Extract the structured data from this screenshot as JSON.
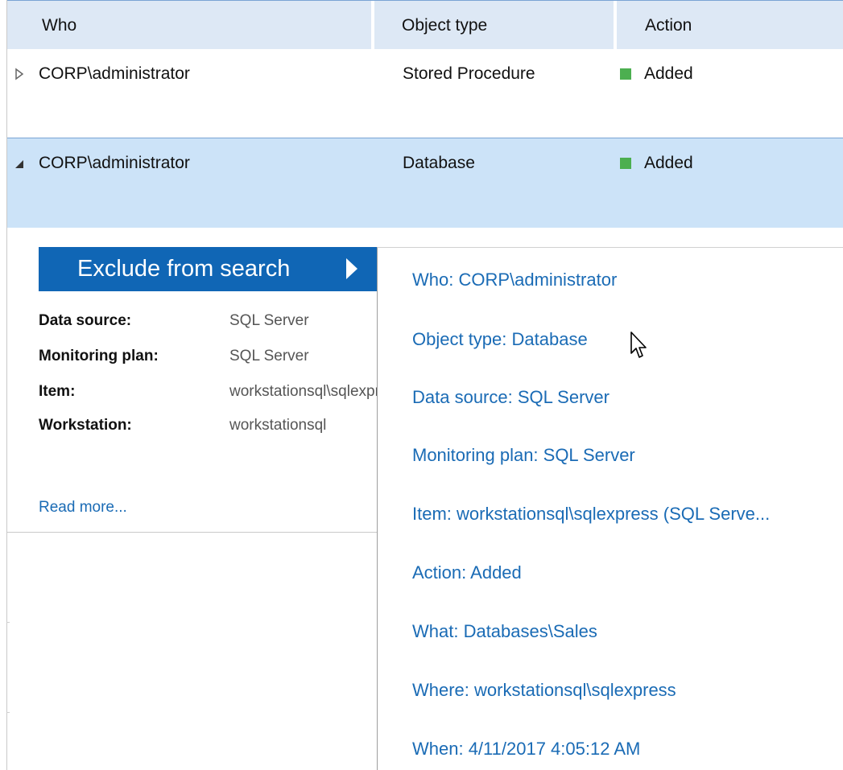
{
  "header": {
    "who": "Who",
    "object_type": "Object type",
    "action": "Action"
  },
  "rows": [
    {
      "who": "CORP\\administrator",
      "object_type": "Stored Procedure",
      "action": "Added",
      "expanded": false
    },
    {
      "who": "CORP\\administrator",
      "object_type": "Database",
      "action": "Added",
      "expanded": true
    }
  ],
  "detail": {
    "exclude_label": "Exclude from search",
    "properties": [
      {
        "label": "Data source:",
        "value": "SQL Server"
      },
      {
        "label": "Monitoring plan:",
        "value": "SQL Server"
      },
      {
        "label": "Item:",
        "value": "workstationsql\\sqlexpress"
      },
      {
        "label": "Workstation:",
        "value": "workstationsql"
      }
    ],
    "read_more": "Read more..."
  },
  "menu": {
    "items": [
      "Who: CORP\\administrator",
      "Object type: Database",
      "Data source: SQL Server",
      "Monitoring plan: SQL Server",
      "Item: workstationsql\\sqlexpress (SQL Serve...",
      "Action: Added",
      "What: Databases\\Sales",
      "Where: workstationsql\\sqlexpress",
      "When: 4/11/2017 4:05:12 AM"
    ]
  },
  "colors": {
    "accent": "#1066b5",
    "link": "#1a6bb5",
    "selected_row": "#cce3f8",
    "header_bg": "#dde8f5",
    "status_added": "#4caf50"
  },
  "icons": {
    "collapsed": "triangle-right-outline-icon",
    "expanded": "triangle-down-filled-icon",
    "exclude_arrow": "submenu-arrow-icon",
    "cursor": "mouse-pointer-icon"
  }
}
